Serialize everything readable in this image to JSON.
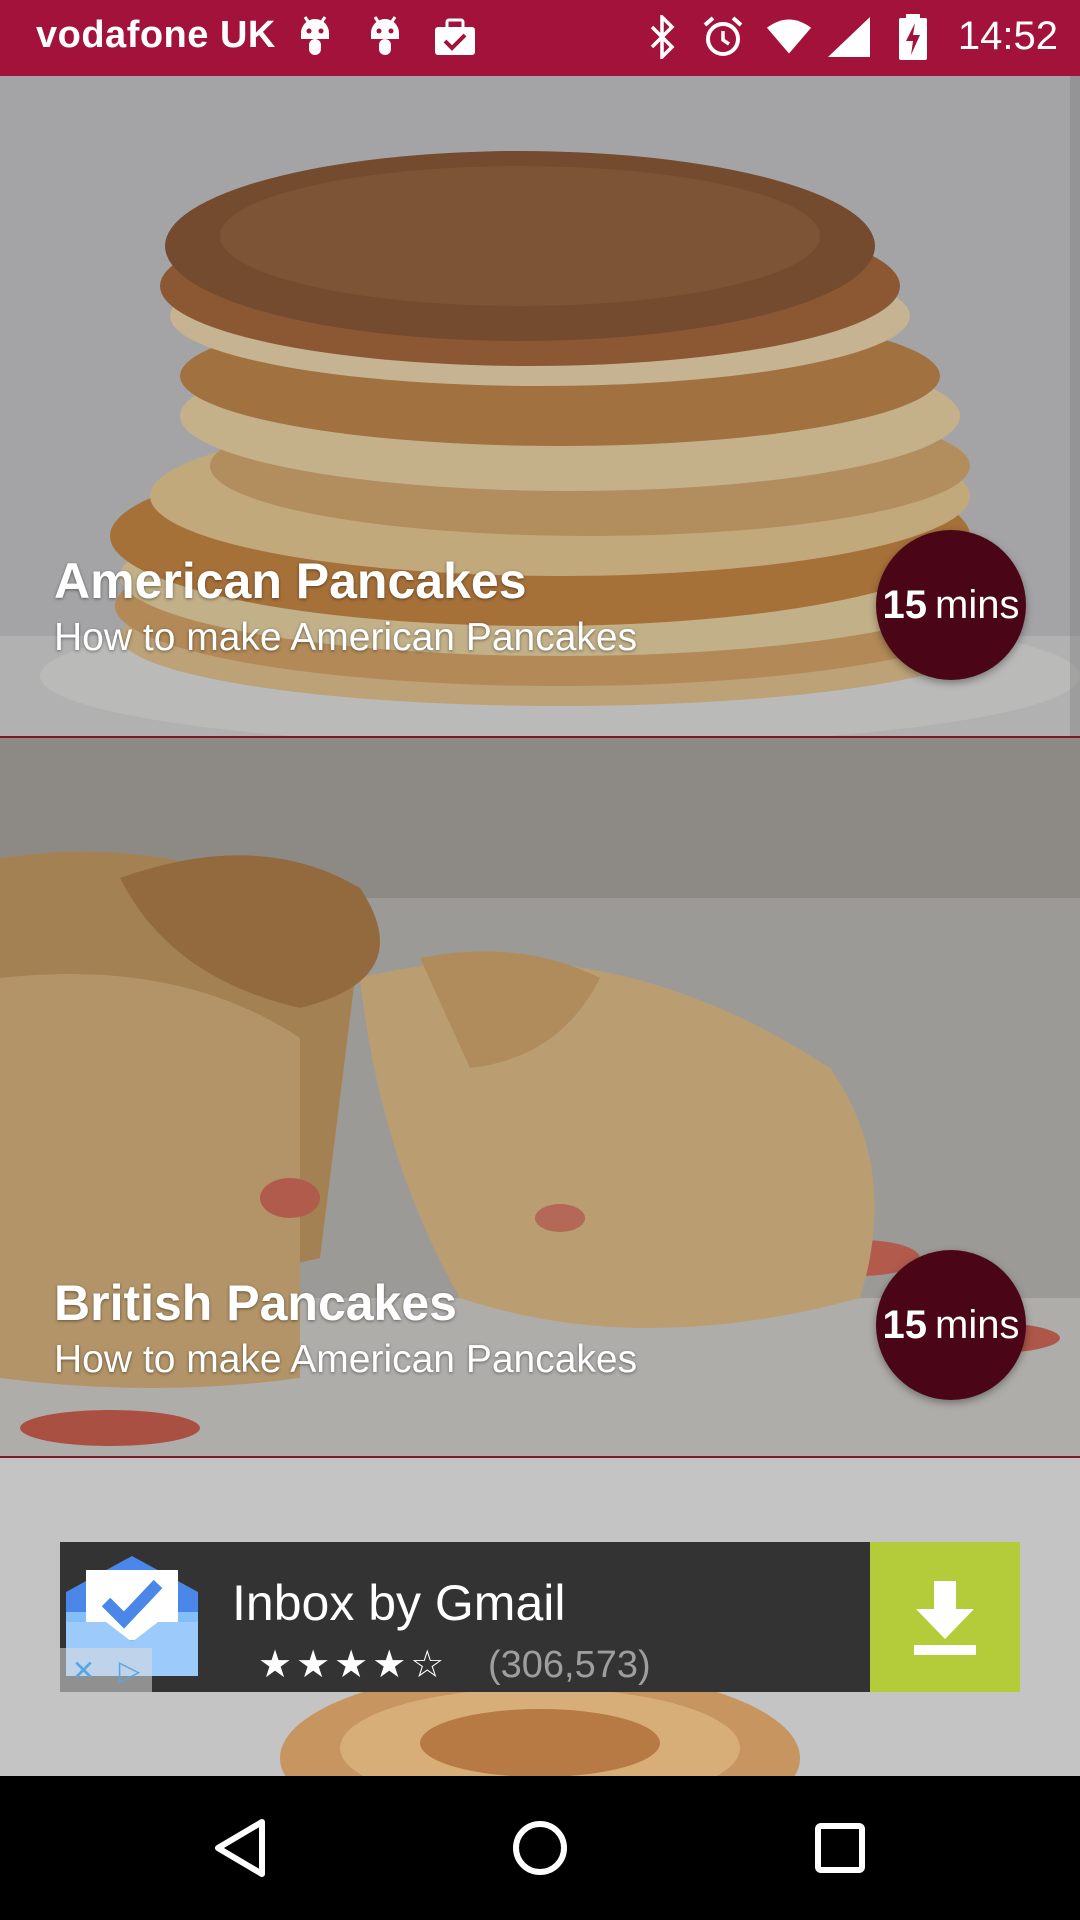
{
  "status_bar": {
    "carrier": "vodafone UK",
    "time": "14:52",
    "background": "#a3123a",
    "icons": [
      "android-icon",
      "android-icon",
      "briefcase-check-icon",
      "bluetooth-icon",
      "alarm-icon",
      "wifi-icon",
      "signal-icon",
      "battery-charging-icon"
    ]
  },
  "recipes": [
    {
      "title": "American Pancakes",
      "subtitle": "How to make American Pancakes",
      "time_value": "15",
      "time_unit": "mins"
    },
    {
      "title": "British Pancakes",
      "subtitle": "How to make American Pancakes",
      "time_value": "15",
      "time_unit": "mins"
    }
  ],
  "ad": {
    "title": "Inbox by Gmail",
    "stars": "★★★★☆",
    "rating_count": "(306,573)",
    "download_color": "#b4cc3a"
  },
  "nav_bar": {
    "buttons": [
      "back-icon",
      "home-icon",
      "recents-icon"
    ]
  },
  "colors": {
    "accent": "#a3123a",
    "badge": "#4a0616"
  }
}
